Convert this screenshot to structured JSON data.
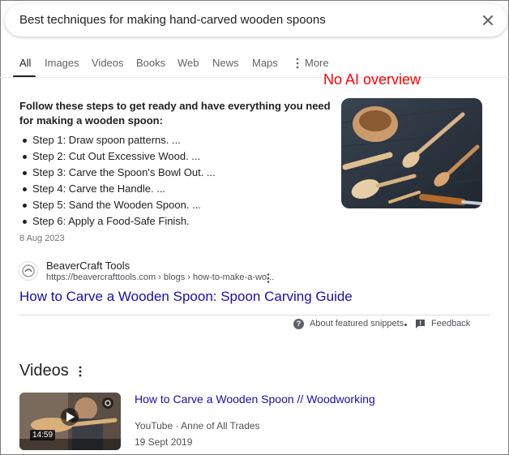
{
  "search": {
    "query": "Best techniques for making hand-carved wooden spoons"
  },
  "tabs": [
    {
      "label": "All",
      "active": true
    },
    {
      "label": "Images"
    },
    {
      "label": "Videos"
    },
    {
      "label": "Books"
    },
    {
      "label": "Web"
    },
    {
      "label": "News"
    },
    {
      "label": "Maps"
    },
    {
      "label": "More"
    }
  ],
  "annotation": {
    "text": "No AI overview",
    "color": "#ff0000"
  },
  "featured_snippet": {
    "heading": "Follow these steps to get ready and have everything you need for making a wooden spoon:",
    "steps": [
      "Step 1: Draw spoon patterns. ...",
      "Step 2: Cut Out Excessive Wood. ...",
      "Step 3: Carve the Spoon's Bowl Out. ...",
      "Step 4: Carve the Handle. ...",
      "Step 5: Sand the Wooden Spoon. ...",
      "Step 6: Apply a Food-Safe Finish."
    ],
    "date": "8 Aug 2023",
    "image_icon": "wooden-spoons-photo",
    "source": {
      "name": "BeaverCraft Tools",
      "url": "https://beavercrafttools.com › blogs › how-to-make-a-wo..."
    },
    "title": "How to Carve a Wooden Spoon: Spoon Carving Guide",
    "about_label": "About featured snippets",
    "feedback_label": "Feedback"
  },
  "videos": {
    "heading": "Videos",
    "items": [
      {
        "title": "How to Carve a Wooden Spoon // Woodworking",
        "meta": "YouTube · Anne of All Trades",
        "date": "19 Sept 2019",
        "duration": "14:59"
      }
    ]
  },
  "colors": {
    "link": "#1a0dab",
    "text": "#202124",
    "muted": "#5f6368"
  }
}
